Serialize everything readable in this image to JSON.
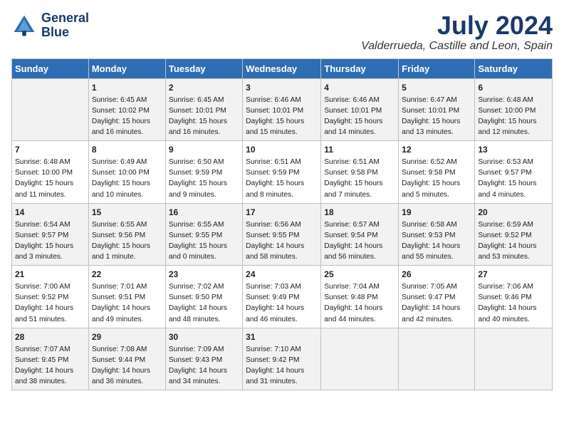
{
  "header": {
    "logo_line1": "General",
    "logo_line2": "Blue",
    "month": "July 2024",
    "location": "Valderrueda, Castille and Leon, Spain"
  },
  "days_of_week": [
    "Sunday",
    "Monday",
    "Tuesday",
    "Wednesday",
    "Thursday",
    "Friday",
    "Saturday"
  ],
  "weeks": [
    [
      {
        "day": "",
        "info": ""
      },
      {
        "day": "1",
        "info": "Sunrise: 6:45 AM\nSunset: 10:02 PM\nDaylight: 15 hours\nand 16 minutes."
      },
      {
        "day": "2",
        "info": "Sunrise: 6:45 AM\nSunset: 10:01 PM\nDaylight: 15 hours\nand 16 minutes."
      },
      {
        "day": "3",
        "info": "Sunrise: 6:46 AM\nSunset: 10:01 PM\nDaylight: 15 hours\nand 15 minutes."
      },
      {
        "day": "4",
        "info": "Sunrise: 6:46 AM\nSunset: 10:01 PM\nDaylight: 15 hours\nand 14 minutes."
      },
      {
        "day": "5",
        "info": "Sunrise: 6:47 AM\nSunset: 10:01 PM\nDaylight: 15 hours\nand 13 minutes."
      },
      {
        "day": "6",
        "info": "Sunrise: 6:48 AM\nSunset: 10:00 PM\nDaylight: 15 hours\nand 12 minutes."
      }
    ],
    [
      {
        "day": "7",
        "info": "Sunrise: 6:48 AM\nSunset: 10:00 PM\nDaylight: 15 hours\nand 11 minutes."
      },
      {
        "day": "8",
        "info": "Sunrise: 6:49 AM\nSunset: 10:00 PM\nDaylight: 15 hours\nand 10 minutes."
      },
      {
        "day": "9",
        "info": "Sunrise: 6:50 AM\nSunset: 9:59 PM\nDaylight: 15 hours\nand 9 minutes."
      },
      {
        "day": "10",
        "info": "Sunrise: 6:51 AM\nSunset: 9:59 PM\nDaylight: 15 hours\nand 8 minutes."
      },
      {
        "day": "11",
        "info": "Sunrise: 6:51 AM\nSunset: 9:58 PM\nDaylight: 15 hours\nand 7 minutes."
      },
      {
        "day": "12",
        "info": "Sunrise: 6:52 AM\nSunset: 9:58 PM\nDaylight: 15 hours\nand 5 minutes."
      },
      {
        "day": "13",
        "info": "Sunrise: 6:53 AM\nSunset: 9:57 PM\nDaylight: 15 hours\nand 4 minutes."
      }
    ],
    [
      {
        "day": "14",
        "info": "Sunrise: 6:54 AM\nSunset: 9:57 PM\nDaylight: 15 hours\nand 3 minutes."
      },
      {
        "day": "15",
        "info": "Sunrise: 6:55 AM\nSunset: 9:56 PM\nDaylight: 15 hours\nand 1 minute."
      },
      {
        "day": "16",
        "info": "Sunrise: 6:55 AM\nSunset: 9:55 PM\nDaylight: 15 hours\nand 0 minutes."
      },
      {
        "day": "17",
        "info": "Sunrise: 6:56 AM\nSunset: 9:55 PM\nDaylight: 14 hours\nand 58 minutes."
      },
      {
        "day": "18",
        "info": "Sunrise: 6:57 AM\nSunset: 9:54 PM\nDaylight: 14 hours\nand 56 minutes."
      },
      {
        "day": "19",
        "info": "Sunrise: 6:58 AM\nSunset: 9:53 PM\nDaylight: 14 hours\nand 55 minutes."
      },
      {
        "day": "20",
        "info": "Sunrise: 6:59 AM\nSunset: 9:52 PM\nDaylight: 14 hours\nand 53 minutes."
      }
    ],
    [
      {
        "day": "21",
        "info": "Sunrise: 7:00 AM\nSunset: 9:52 PM\nDaylight: 14 hours\nand 51 minutes."
      },
      {
        "day": "22",
        "info": "Sunrise: 7:01 AM\nSunset: 9:51 PM\nDaylight: 14 hours\nand 49 minutes."
      },
      {
        "day": "23",
        "info": "Sunrise: 7:02 AM\nSunset: 9:50 PM\nDaylight: 14 hours\nand 48 minutes."
      },
      {
        "day": "24",
        "info": "Sunrise: 7:03 AM\nSunset: 9:49 PM\nDaylight: 14 hours\nand 46 minutes."
      },
      {
        "day": "25",
        "info": "Sunrise: 7:04 AM\nSunset: 9:48 PM\nDaylight: 14 hours\nand 44 minutes."
      },
      {
        "day": "26",
        "info": "Sunrise: 7:05 AM\nSunset: 9:47 PM\nDaylight: 14 hours\nand 42 minutes."
      },
      {
        "day": "27",
        "info": "Sunrise: 7:06 AM\nSunset: 9:46 PM\nDaylight: 14 hours\nand 40 minutes."
      }
    ],
    [
      {
        "day": "28",
        "info": "Sunrise: 7:07 AM\nSunset: 9:45 PM\nDaylight: 14 hours\nand 38 minutes."
      },
      {
        "day": "29",
        "info": "Sunrise: 7:08 AM\nSunset: 9:44 PM\nDaylight: 14 hours\nand 36 minutes."
      },
      {
        "day": "30",
        "info": "Sunrise: 7:09 AM\nSunset: 9:43 PM\nDaylight: 14 hours\nand 34 minutes."
      },
      {
        "day": "31",
        "info": "Sunrise: 7:10 AM\nSunset: 9:42 PM\nDaylight: 14 hours\nand 31 minutes."
      },
      {
        "day": "",
        "info": ""
      },
      {
        "day": "",
        "info": ""
      },
      {
        "day": "",
        "info": ""
      }
    ]
  ]
}
